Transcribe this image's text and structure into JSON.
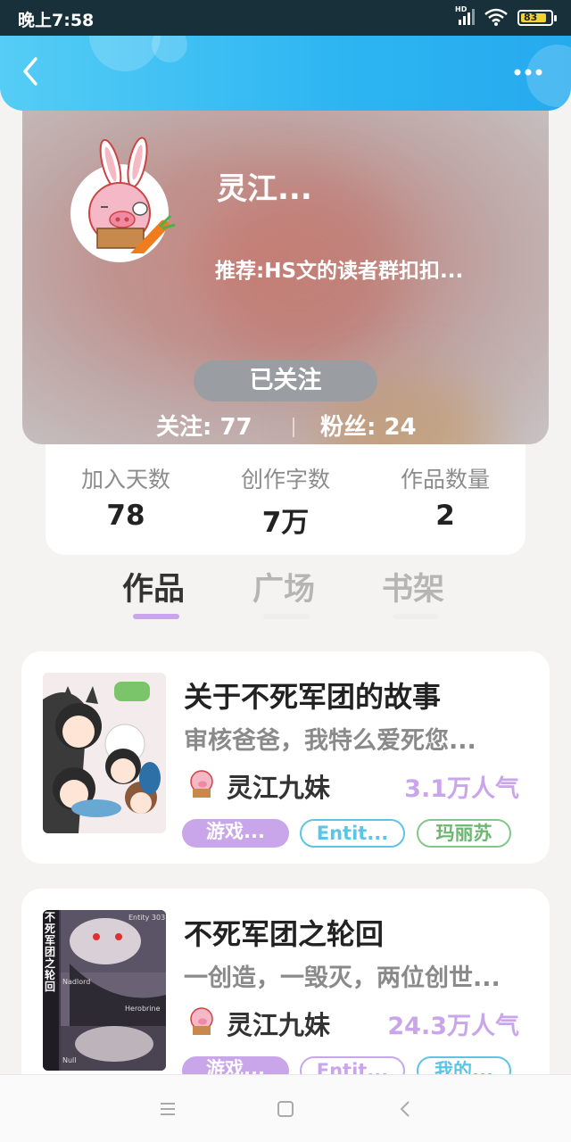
{
  "status_bar": {
    "time": "晚上7:58",
    "network": "HD",
    "battery": "83"
  },
  "header": {
    "back_icon": "chevron-left-icon",
    "more_icon": "more-dots-icon"
  },
  "profile": {
    "name": "灵江...",
    "recommend": "推荐:HS文的读者群扣扣...",
    "follow_button": "已关注",
    "following": "关注: 77",
    "fans": "粉丝: 24"
  },
  "stats": [
    {
      "label": "加入天数",
      "value": "78"
    },
    {
      "label": "创作字数",
      "value": "7万"
    },
    {
      "label": "作品数量",
      "value": "2"
    }
  ],
  "tabs": [
    {
      "label": "作品",
      "active": true
    },
    {
      "label": "广场",
      "active": false
    },
    {
      "label": "书架",
      "active": false
    }
  ],
  "works": [
    {
      "title": "关于不死军团的故事",
      "desc": "审核爸爸，我特么爱死您...",
      "author": "灵江九妹",
      "popularity": "3.1万人气",
      "tags": [
        "游戏...",
        "Entit...",
        "玛丽苏"
      ]
    },
    {
      "title": "不死军团之轮回",
      "desc": "一创造，一毁灭，两位创世...",
      "author": "灵江九妹",
      "popularity": "24.3万人气",
      "tags": [
        "游戏...",
        "Entit...",
        "我的..."
      ],
      "cover_text": "不死军团之轮回",
      "cover_labels": [
        "Entity 303",
        "Nadlord",
        "Herobrine",
        "Null"
      ]
    }
  ],
  "colors": {
    "header": "#2db5f2",
    "accent_purple": "#c9a6ea",
    "tag_blue": "#5cc5e6",
    "tag_green": "#84c78a"
  },
  "nav": {
    "menu_icon": "menu-icon",
    "home_icon": "home-square-icon",
    "back_icon": "back-triangle-icon"
  }
}
